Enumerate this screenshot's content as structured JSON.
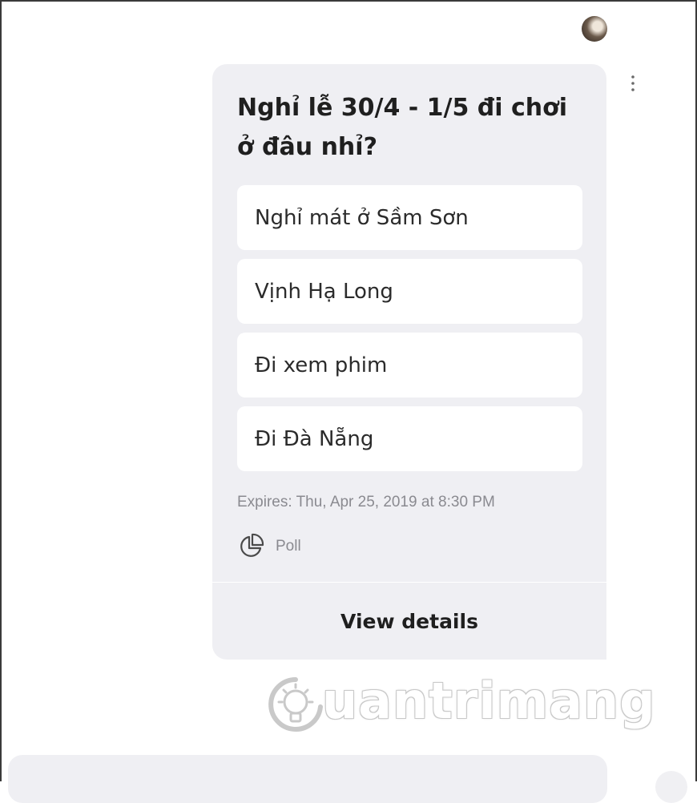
{
  "poll": {
    "question": "Nghỉ lễ 30/4 - 1/5 đi chơi ở đâu nhỉ?",
    "options": [
      "Nghỉ mát ở Sầm Sơn",
      "Vịnh Hạ Long",
      "Đi xem phim",
      "Đi Đà Nẵng"
    ],
    "expires": "Expires: Thu, Apr 25, 2019 at 8:30 PM",
    "type_label": "Poll",
    "view_details_label": "View details"
  },
  "icons": {
    "poll": "pie-chart-icon",
    "more": "more-vertical-icon",
    "watermark_bulb": "lightbulb-icon"
  },
  "watermark": {
    "text": "uantrimang"
  },
  "colors": {
    "bubble_background": "#efeff3",
    "option_background": "#ffffff",
    "meta_text": "#8a8a90"
  }
}
